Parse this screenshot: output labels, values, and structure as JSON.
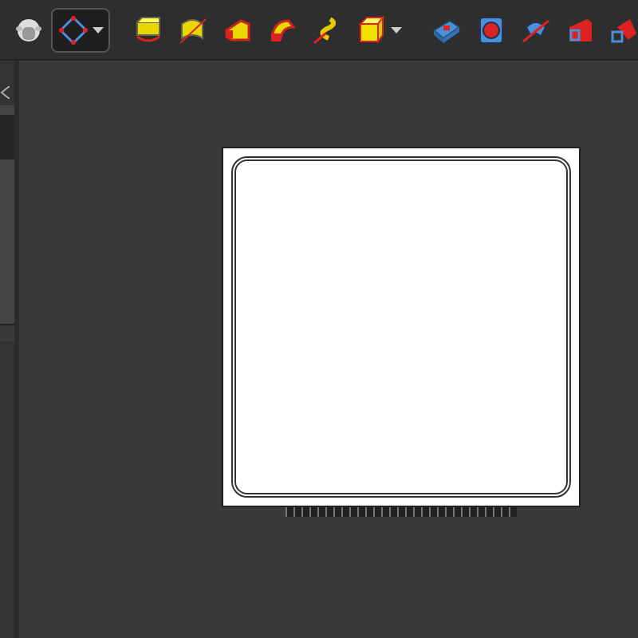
{
  "toolbar": {
    "items": [
      {
        "kind": "workbench",
        "selected": false,
        "dropdown": false
      },
      {
        "kind": "sketch",
        "selected": true,
        "dropdown": true
      },
      {
        "kind": "separator"
      },
      {
        "kind": "pad",
        "selected": false,
        "dropdown": false
      },
      {
        "kind": "revolution",
        "selected": false,
        "dropdown": false
      },
      {
        "kind": "additive-loft",
        "selected": false,
        "dropdown": false
      },
      {
        "kind": "additive-pipe",
        "selected": false,
        "dropdown": false
      },
      {
        "kind": "additive-helix",
        "selected": false,
        "dropdown": false
      },
      {
        "kind": "additive-primitive",
        "selected": false,
        "dropdown": true
      },
      {
        "kind": "separator"
      },
      {
        "kind": "pocket",
        "selected": false,
        "dropdown": false
      },
      {
        "kind": "hole",
        "selected": false,
        "dropdown": false
      },
      {
        "kind": "groove",
        "selected": false,
        "dropdown": false
      },
      {
        "kind": "subtractive-loft",
        "selected": false,
        "dropdown": false
      },
      {
        "kind": "subtractive-pipe",
        "selected": false,
        "dropdown": false
      }
    ]
  },
  "side_panel": {
    "closable": true
  },
  "canvas": {
    "page": {
      "kind": "sheet"
    }
  }
}
